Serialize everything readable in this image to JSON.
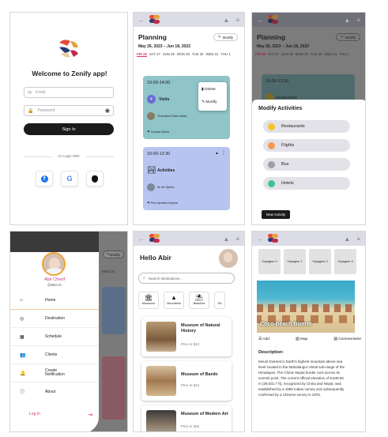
{
  "login": {
    "welcome": "Welcome to Zenify app!",
    "email_placeholder": "Email",
    "password_placeholder": "Password",
    "signin_label": "Sign In",
    "or_login_with": "Or Login With"
  },
  "planning": {
    "title": "Planning",
    "modify_label": "Modify",
    "date_range": "May 26, 2023 – Jun 18, 2023",
    "days": [
      "FRI 26",
      "SAT 27",
      "SUN 28",
      "MON 29",
      "TUE 30",
      "WED 31",
      "THU 1"
    ],
    "card1": {
      "time": "10:00-14:00",
      "label": "Visits",
      "place": "Trocadero Eiars News",
      "footer": "Yucosa Zebra"
    },
    "card2": {
      "time": "10:00-12:30",
      "label": "Activities",
      "place": "Ile de Djerba",
      "footer": "Pier Ejemba Explore"
    },
    "menu": {
      "delete": "Delete",
      "modify": "Modify"
    }
  },
  "modify": {
    "title": "Planning",
    "modify_label": "Modify",
    "date_range": "May 26, 2023 – Jun 18, 2023",
    "days": [
      "FRI 26",
      "SAT 27",
      "SUN 28",
      "MON 29",
      "TUE 30",
      "WED 31",
      "THU 1"
    ],
    "card_time": "10:00-12:30",
    "card_label": "Restaurants",
    "sheet_title": "Modify Activities",
    "items": [
      "Restaurants",
      "Flights",
      "Bus",
      "Hotels"
    ],
    "new_activity": "New Activity"
  },
  "drawer": {
    "name": "Abir Cherif",
    "handle": "@abir.ch",
    "items": [
      "Home",
      "Destination",
      "Schedule",
      "Clients",
      "Create Notification",
      "About"
    ],
    "logout": "Log In",
    "modify_label": "Modify",
    "day_label": "WED 31"
  },
  "home": {
    "greeting": "Hello Abir",
    "search_placeholder": "Search destinations...",
    "categories": [
      "Museums",
      "Mountains",
      "Beaches",
      "Pa"
    ],
    "cards": [
      {
        "title": "Museum of Natural History",
        "price": "Price is: $13"
      },
      {
        "title": "Museum of Bardo",
        "price": "Price is: $44"
      },
      {
        "title": "Museum of Modern Art",
        "price": "Price is: $25"
      }
    ]
  },
  "detail": {
    "tabs": [
      "Voyageur 0",
      "Voyageur 1",
      "Voyageur 2",
      "Voyageur 3"
    ],
    "place_title": "Coco Beach Bizerte",
    "actions": [
      "Add",
      "Map",
      "Commentaire"
    ],
    "desc_heading": "Description:",
    "description": "Mount Everest is Earth's highest mountain above sea level located in the Mahalangur Himal sub-range of the Himalayas. The China–Nepal border runs across its summit point. The current official elevation of 8,848.86 m (29,031.7 ft), recognized by China and Nepal, was established by a 1955 Indian survey and subsequently confirmed by a Chinese survey in 1975."
  },
  "colors": {
    "teal_card": "#8fc4c8",
    "blue_card": "#b8c4f0",
    "accent": "#e0335a",
    "dark_button": "#1b1b1b"
  }
}
